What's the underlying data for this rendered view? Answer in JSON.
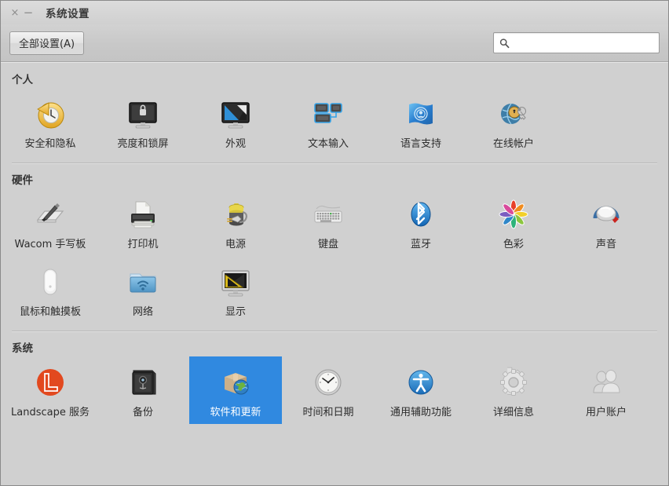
{
  "window": {
    "title": "系统设置",
    "close_label": "×",
    "minimize_label": "−"
  },
  "toolbar": {
    "all_settings_label": "全部设置(A)",
    "search_placeholder": "",
    "search_value": "",
    "search_icon": "search-icon"
  },
  "colors": {
    "selection": "#3089e0",
    "window_bg": "#d0d0d0",
    "titlebar_bg": "#d4d4d4",
    "text": "#2d2d2d",
    "selected_text": "#ffffff"
  },
  "sections": [
    {
      "id": "personal",
      "title": "个人",
      "items": [
        {
          "label": "安全和隐私",
          "icon": "security-privacy-icon",
          "selected": false
        },
        {
          "label": "亮度和锁屏",
          "icon": "brightness-lock-icon",
          "selected": false
        },
        {
          "label": "外观",
          "icon": "appearance-icon",
          "selected": false
        },
        {
          "label": "文本输入",
          "icon": "text-entry-icon",
          "selected": false
        },
        {
          "label": "语言支持",
          "icon": "language-support-icon",
          "selected": false
        },
        {
          "label": "在线帐户",
          "icon": "online-accounts-icon",
          "selected": false
        }
      ]
    },
    {
      "id": "hardware",
      "title": "硬件",
      "items": [
        {
          "label": "Wacom 手写板",
          "icon": "wacom-tablet-icon",
          "selected": false
        },
        {
          "label": "打印机",
          "icon": "printer-icon",
          "selected": false
        },
        {
          "label": "电源",
          "icon": "power-icon",
          "selected": false
        },
        {
          "label": "键盘",
          "icon": "keyboard-icon",
          "selected": false
        },
        {
          "label": "蓝牙",
          "icon": "bluetooth-icon",
          "selected": false
        },
        {
          "label": "色彩",
          "icon": "color-icon",
          "selected": false
        },
        {
          "label": "声音",
          "icon": "sound-icon",
          "selected": false
        },
        {
          "label": "鼠标和触摸板",
          "icon": "mouse-touchpad-icon",
          "selected": false
        },
        {
          "label": "网络",
          "icon": "network-icon",
          "selected": false
        },
        {
          "label": "显示",
          "icon": "displays-icon",
          "selected": false
        }
      ]
    },
    {
      "id": "system",
      "title": "系统",
      "items": [
        {
          "label": "Landscape 服务",
          "icon": "landscape-service-icon",
          "selected": false
        },
        {
          "label": "备份",
          "icon": "backup-icon",
          "selected": false
        },
        {
          "label": "软件和更新",
          "icon": "software-updates-icon",
          "selected": true
        },
        {
          "label": "时间和日期",
          "icon": "time-date-icon",
          "selected": false
        },
        {
          "label": "通用辅助功能",
          "icon": "universal-access-icon",
          "selected": false
        },
        {
          "label": "详细信息",
          "icon": "details-icon",
          "selected": false
        },
        {
          "label": "用户账户",
          "icon": "user-accounts-icon",
          "selected": false
        }
      ]
    }
  ]
}
